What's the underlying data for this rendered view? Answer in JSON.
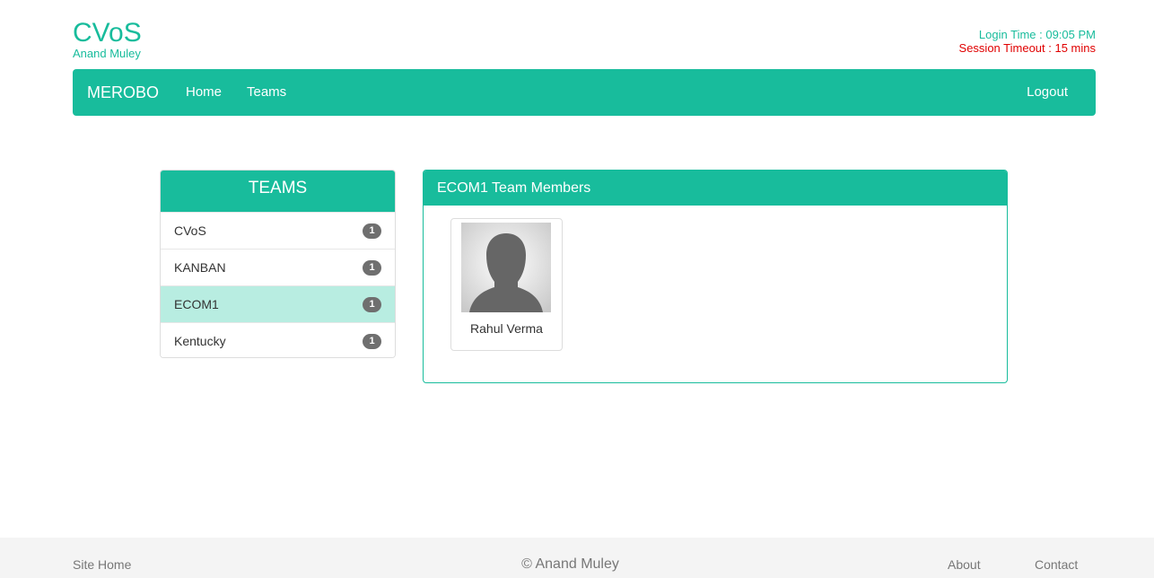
{
  "header": {
    "title": "CVoS",
    "user": "Anand Muley",
    "login_time": "Login Time : 09:05 PM",
    "session_timeout": "Session Timeout : 15 mins"
  },
  "navbar": {
    "brand": "MEROBO",
    "home": "Home",
    "teams": "Teams",
    "logout": "Logout"
  },
  "teams_panel": {
    "heading": "TEAMS",
    "items": [
      {
        "label": "CVoS",
        "count": "1"
      },
      {
        "label": "KANBAN",
        "count": "1"
      },
      {
        "label": "ECOM1",
        "count": "1",
        "active": true
      },
      {
        "label": "Kentucky",
        "count": "1"
      }
    ]
  },
  "members_panel": {
    "heading": "ECOM1 Team Members",
    "members": [
      {
        "name": "Rahul Verma",
        "avatar_icon": "user-silhouette-icon"
      }
    ]
  },
  "footer": {
    "site_home": "Site Home",
    "copyright": "© Anand Muley",
    "about": "About",
    "contact": "Contact"
  },
  "colors": {
    "accent": "#18bc9c",
    "active_row": "#b8ede1",
    "timeout": "#e00000",
    "badge": "#6f6f6f"
  }
}
